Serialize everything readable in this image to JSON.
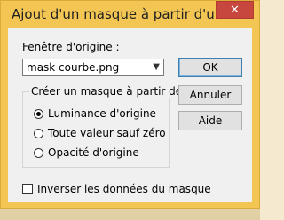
{
  "window": {
    "title": "Ajout d'un masque à partir d'une i...",
    "close_glyph": "✕"
  },
  "source": {
    "label": "Fenêtre d'origine :",
    "selected": "mask courbe.png"
  },
  "group": {
    "label": "Créer un masque à partir de",
    "options": [
      {
        "label": "Luminance d'origine",
        "checked": true
      },
      {
        "label": "Toute valeur sauf zéro",
        "checked": false
      },
      {
        "label": "Opacité d'origine",
        "checked": false
      }
    ]
  },
  "buttons": {
    "ok": "OK",
    "cancel": "Annuler",
    "help": "Aide"
  },
  "invert": {
    "label": "Inverser les données du masque",
    "checked": false
  },
  "colors": {
    "titlebar": "#f3c553",
    "close": "#c7463d",
    "client": "#f0f0f0"
  }
}
